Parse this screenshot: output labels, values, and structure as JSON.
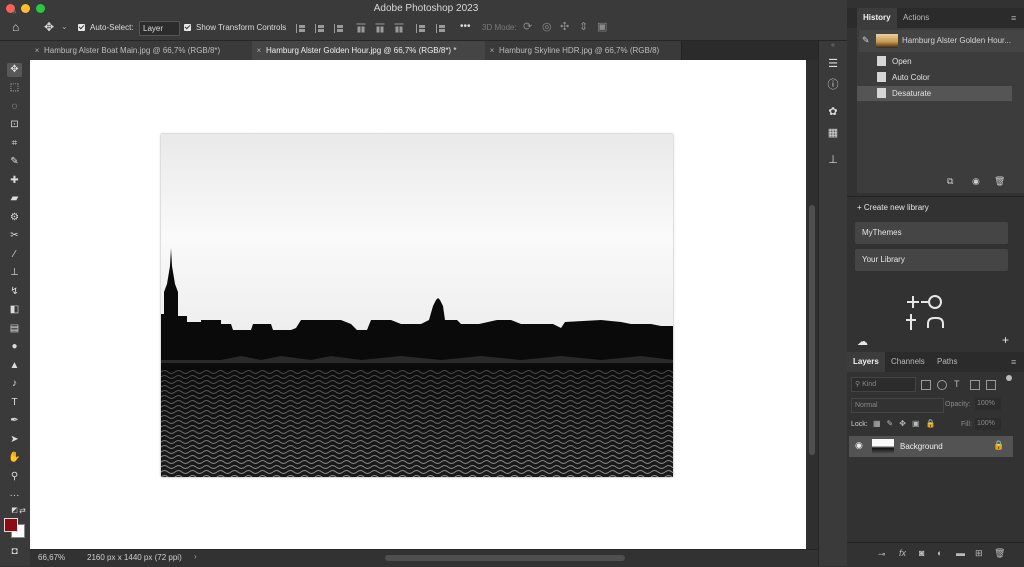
{
  "window": {
    "title": "Adobe Photoshop 2023"
  },
  "options_bar": {
    "auto_select_label": "Auto-Select:",
    "layer_select_value": "Layer",
    "show_transform_label": "Show Transform Controls",
    "mode_3d_label": "3D Mode:",
    "more_label": "•••"
  },
  "tabs": [
    {
      "label": "Hamburg Alster Boat Main.jpg @ 66,7% (RGB/8*)",
      "close": "×"
    },
    {
      "label": "Hamburg Alster Golden Hour.jpg @ 66,7% (RGB/8*) *",
      "close": "×"
    },
    {
      "label": "Hamburg Skyline HDR.jpg @ 66,7% (RGB/8)",
      "close": "×"
    }
  ],
  "status": {
    "zoom": "66,67%",
    "doc_size": "2160 px x 1440 px (72 ppi)",
    "arrow": "›"
  },
  "history_panel": {
    "tabs": [
      "History",
      "Actions"
    ],
    "snapshot_label": "Hamburg Alster Golden Hour...",
    "steps": [
      "Open",
      "Auto Color",
      "Desaturate"
    ]
  },
  "libraries_panel": {
    "create_label": "+ Create new library",
    "libraries": [
      "MyThemes",
      "Your Library"
    ]
  },
  "layers_panel": {
    "tabs": [
      "Layers",
      "Channels",
      "Paths"
    ],
    "filter_placeholder": "Kind",
    "blend_mode": "Normal",
    "opacity_label": "Opacity:",
    "opacity_value": "100%",
    "lock_label": "Lock:",
    "fill_label": "Fill:",
    "fill_value": "100%",
    "layers": [
      {
        "name": "Background",
        "visible": true,
        "locked": true
      }
    ]
  },
  "colors": {
    "foreground": "#8b0c12",
    "background": "#ffffff",
    "accent_panel": "#535353"
  }
}
